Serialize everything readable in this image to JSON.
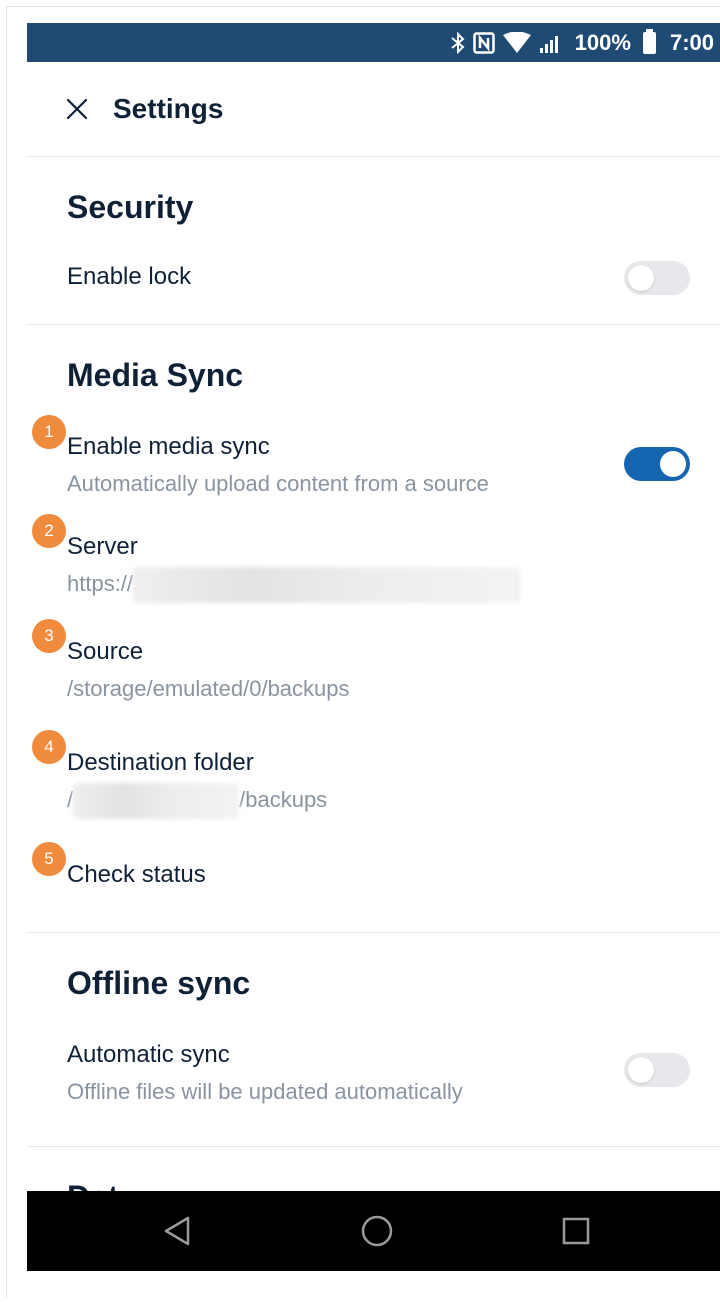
{
  "status_bar": {
    "battery": "100%",
    "time": "7:00",
    "icons": [
      "bluetooth-icon",
      "nfc-icon",
      "wifi-icon",
      "signal-icon",
      "battery-icon"
    ]
  },
  "app_bar": {
    "title": "Settings",
    "close_icon": "close-icon"
  },
  "sections": {
    "security": {
      "title": "Security",
      "enable_lock": {
        "label": "Enable lock",
        "enabled": false
      }
    },
    "media_sync": {
      "title": "Media Sync",
      "enable_media_sync": {
        "label": "Enable media sync",
        "sub": "Automatically upload content from a source",
        "enabled": true,
        "badge": "1"
      },
      "server": {
        "label": "Server",
        "value": "https://",
        "badge": "2"
      },
      "source": {
        "label": "Source",
        "value": "/storage/emulated/0/backups",
        "badge": "3"
      },
      "destination": {
        "label": "Destination folder",
        "value_prefix": "/",
        "value_suffix": "/backups",
        "badge": "4"
      },
      "check_status": {
        "label": "Check status",
        "badge": "5"
      }
    },
    "offline_sync": {
      "title": "Offline sync",
      "automatic_sync": {
        "label": "Automatic sync",
        "sub": "Offline files will be updated automatically",
        "enabled": false
      }
    },
    "next_section": {
      "title_partial": "Dat"
    }
  },
  "nav_bar": {
    "buttons": [
      "back-icon",
      "home-icon",
      "recents-icon"
    ]
  },
  "colors": {
    "status_bar": "#1f4a73",
    "accent": "#1566b0",
    "badge": "#f08a3c",
    "text": "#0f2137",
    "subtext": "#8a94a0"
  }
}
